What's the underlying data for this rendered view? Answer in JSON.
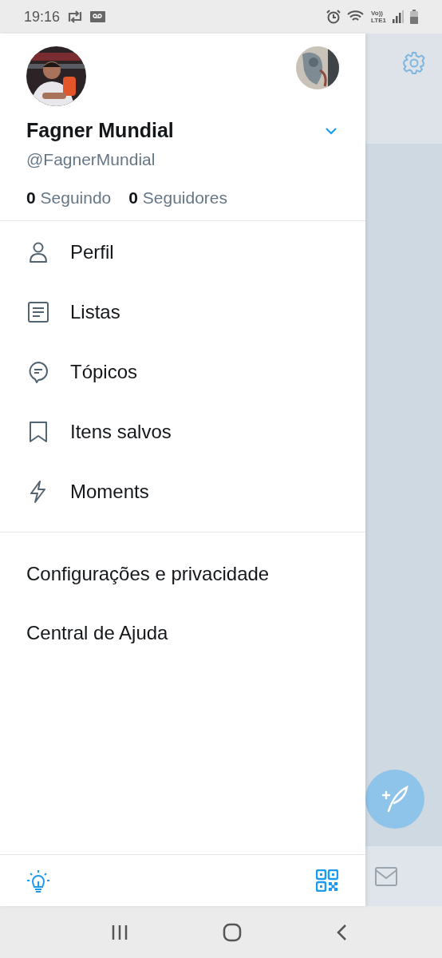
{
  "status_bar": {
    "time": "19:16",
    "network_top": "Vo))",
    "network_bottom": "LTE1"
  },
  "drawer": {
    "profile": {
      "name": "Fagner Mundial",
      "handle": "@FagnerMundial",
      "stats": [
        {
          "count": "0",
          "label": "Seguindo"
        },
        {
          "count": "0",
          "label": "Seguidores"
        }
      ]
    },
    "menu": [
      "Perfil",
      "Listas",
      "Tópicos",
      "Itens salvos",
      "Moments"
    ],
    "links": [
      "Configurações e privacidade",
      "Central de Ajuda"
    ]
  }
}
